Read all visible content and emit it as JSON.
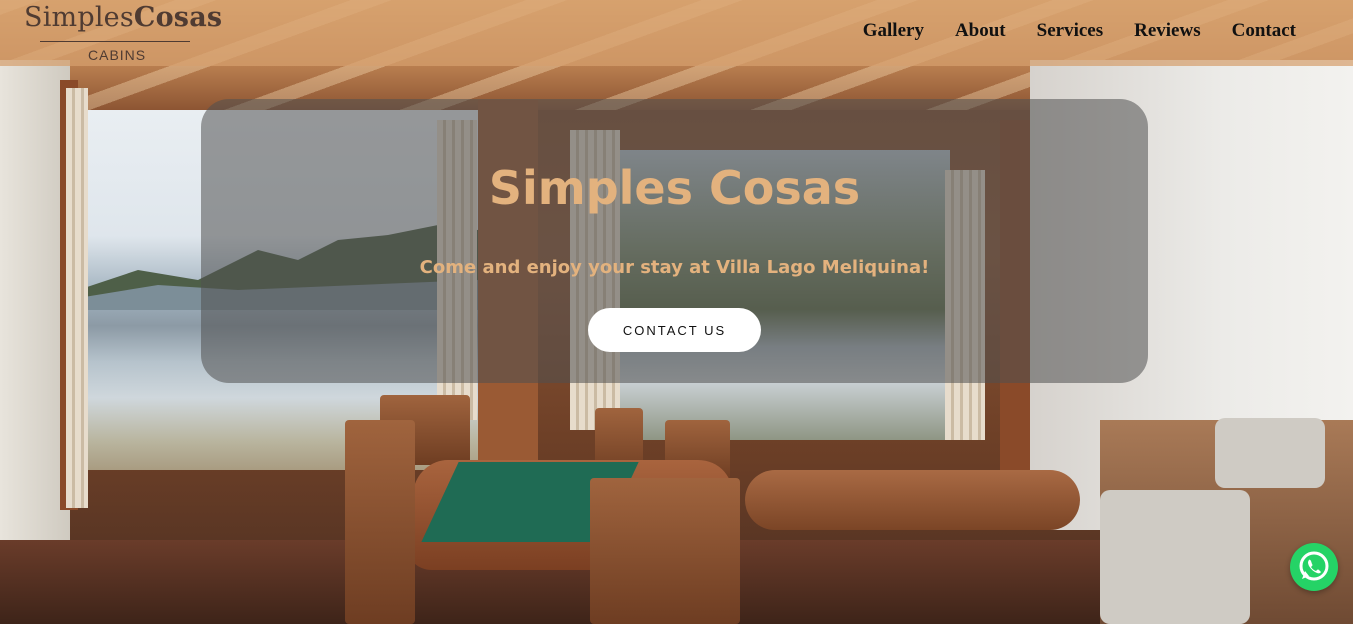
{
  "brand": {
    "name_part1": "Simples",
    "name_part2": "Cosas",
    "tagline": "CABINS"
  },
  "nav": {
    "items": [
      {
        "label": "Gallery"
      },
      {
        "label": "About"
      },
      {
        "label": "Services"
      },
      {
        "label": "Reviews"
      },
      {
        "label": "Contact"
      }
    ]
  },
  "hero": {
    "title": "Simples Cosas",
    "subtitle": "Come and enjoy your stay at Villa Lago Meliquina!",
    "cta_label": "CONTACT US"
  },
  "floating": {
    "whatsapp_icon": "whatsapp-icon"
  },
  "colors": {
    "accent_text": "#e3b27e",
    "header_bg": "#d6a06e",
    "whatsapp_green": "#25d366"
  }
}
